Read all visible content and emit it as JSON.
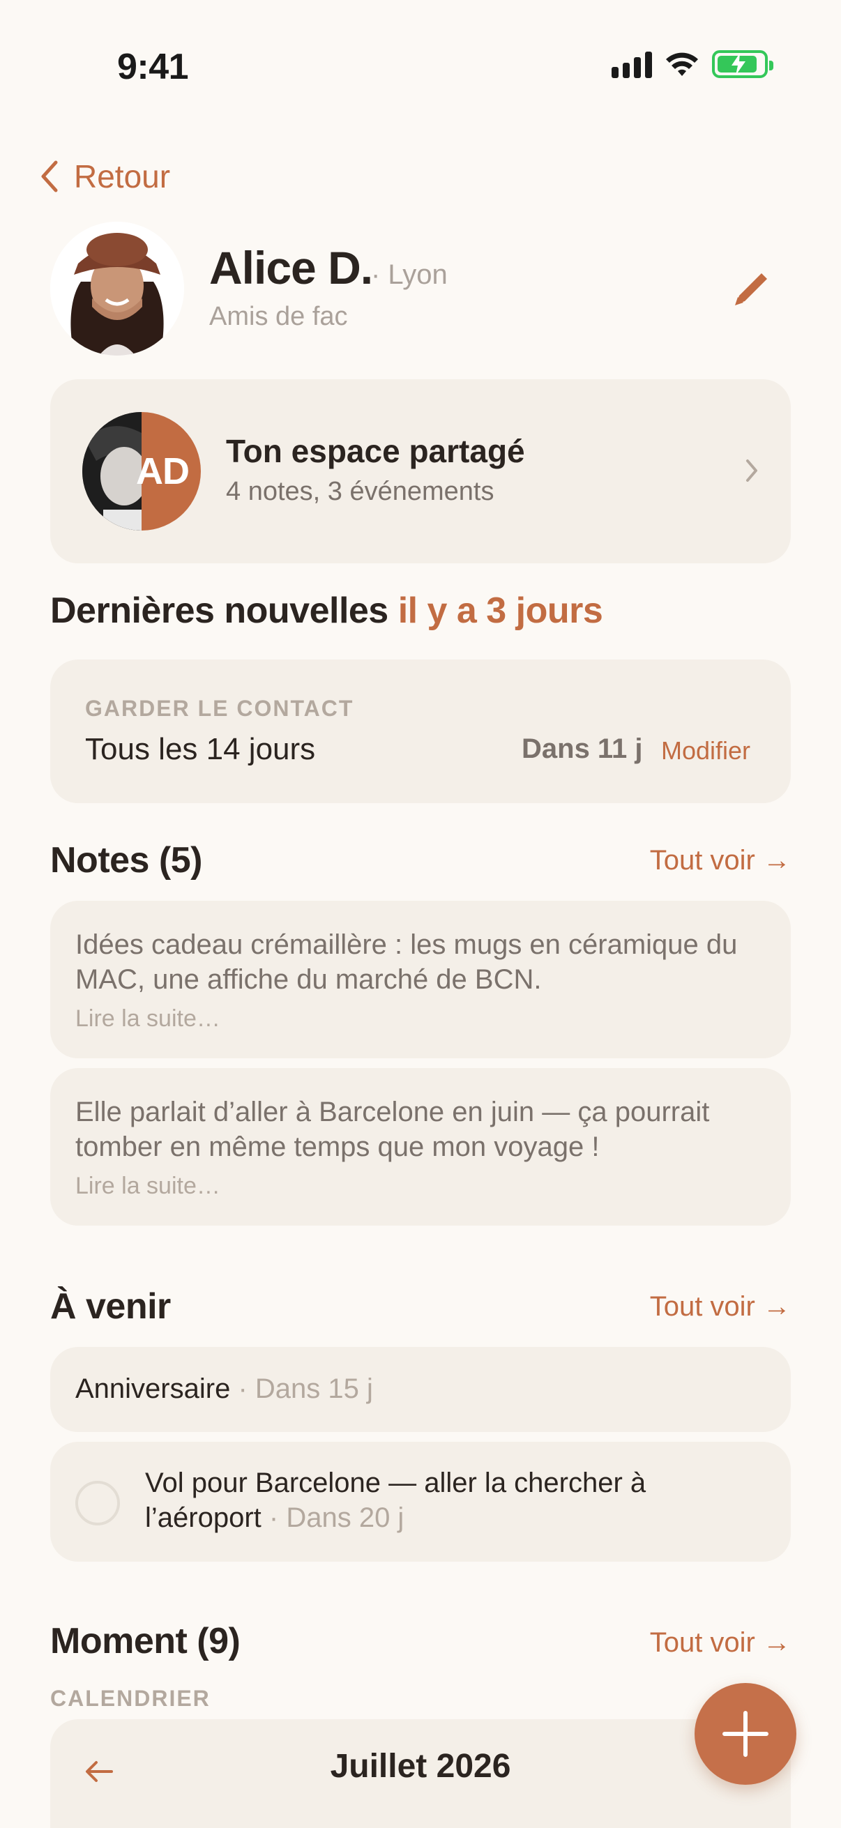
{
  "status_bar": {
    "time": "9:41"
  },
  "nav": {
    "back_label": "Retour"
  },
  "profile": {
    "name": "Alice D.",
    "city": "· Lyon",
    "group": "Amis de fac"
  },
  "shared_space": {
    "initials": "AD",
    "title": "Ton espace partagé",
    "subtitle": "4 notes, 3 événements"
  },
  "latest_news": {
    "label": "Dernières nouvelles",
    "when": "il y a 3 jours"
  },
  "keep_contact": {
    "label": "GARDER LE CONTACT",
    "frequency": "Tous les 14 jours",
    "due": "Dans 11 j",
    "edit_label": "Modifier"
  },
  "notes": {
    "title": "Notes (5)",
    "see_all": "Tout voir →",
    "items": [
      {
        "text": "Idées cadeau crémaillère : les mugs en céramique du MAC, une affiche du marché de BCN.",
        "more": "Lire la suite…"
      },
      {
        "text": "Elle parlait d’aller à Barcelone en juin — ça pourrait tomber en même temps que mon voyage !",
        "more": "Lire la suite…"
      }
    ]
  },
  "upcoming": {
    "title": "À venir",
    "see_all": "Tout voir →",
    "items": [
      {
        "label": "Anniversaire",
        "when": "· Dans 15 j"
      },
      {
        "label": "Vol pour Barcelone — aller la chercher à l’aéroport",
        "when": "· Dans 20 j"
      }
    ]
  },
  "moments": {
    "title": "Moment (9)",
    "see_all": "Tout voir →",
    "calendar_label": "CALENDRIER",
    "month": "Juillet 2026"
  },
  "colors": {
    "accent": "#c26c42",
    "background": "#fcf9f5",
    "card": "#f4efe8",
    "battery": "#34c759"
  },
  "icons": [
    "signal-icon",
    "wifi-icon",
    "battery-charging-icon",
    "chevron-left-icon",
    "pencil-icon",
    "chevron-right-icon",
    "arrow-left-icon",
    "plus-icon"
  ]
}
